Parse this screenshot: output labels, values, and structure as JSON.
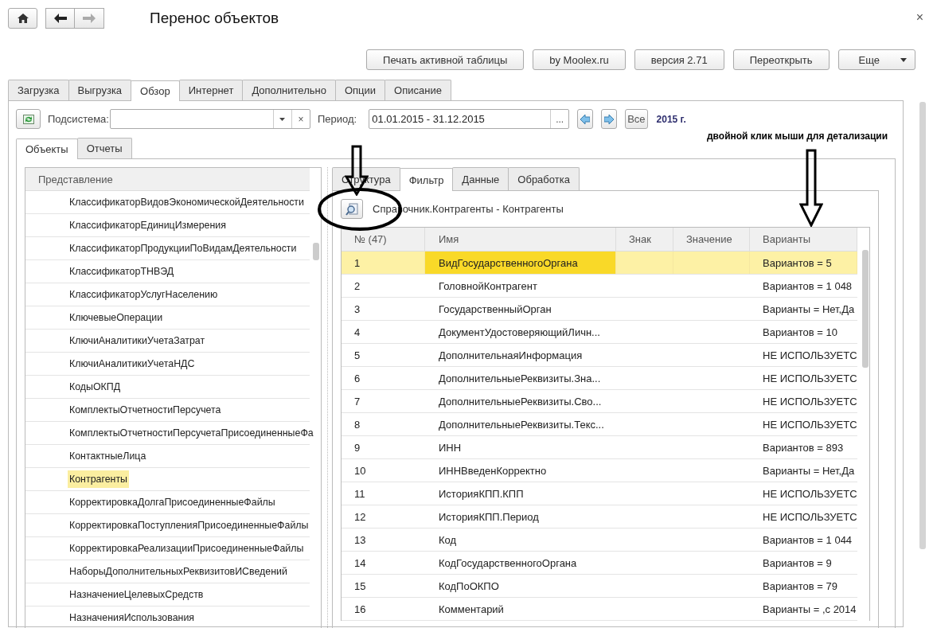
{
  "window": {
    "title": "Перенос объектов",
    "close": "×"
  },
  "commands": [
    {
      "kind": "button",
      "label": "Печать активной таблицы"
    },
    {
      "kind": "button",
      "label": "by Moolex.ru"
    },
    {
      "kind": "button",
      "label": "версия 2.71"
    },
    {
      "kind": "button",
      "label": "Переоткрыть"
    },
    {
      "kind": "menu",
      "label": "Еще"
    }
  ],
  "tabs": [
    {
      "label": "Загрузка",
      "selected": false
    },
    {
      "label": "Выгрузка",
      "selected": false
    },
    {
      "label": "Обзор",
      "selected": true
    },
    {
      "label": "Интернет",
      "selected": false
    },
    {
      "label": "Дополнительно",
      "selected": false
    },
    {
      "label": "Опции",
      "selected": false
    },
    {
      "label": "Описание",
      "selected": false
    }
  ],
  "toolbar": {
    "subsystem_label": "Подсистема:",
    "subsystem_clear": "×",
    "period_label": "Период:",
    "period_value": "01.01.2015 - 31.12.2015",
    "period_choice": "...",
    "all_button": "Все",
    "year": "2015 г."
  },
  "subtabs": [
    {
      "label": "Объекты",
      "selected": true
    },
    {
      "label": "Отчеты",
      "selected": false
    }
  ],
  "object_list": {
    "header": "Представление",
    "items": [
      {
        "label": "КлассификаторВидовЭкономическойДеятельности",
        "selected": false
      },
      {
        "label": "КлассификаторЕдиницИзмерения",
        "selected": false
      },
      {
        "label": "КлассификаторПродукцииПоВидамДеятельности",
        "selected": false
      },
      {
        "label": "КлассификаторТНВЭД",
        "selected": false
      },
      {
        "label": "КлассификаторУслугНаселению",
        "selected": false
      },
      {
        "label": "КлючевыеОперации",
        "selected": false
      },
      {
        "label": "КлючиАналитикиУчетаЗатрат",
        "selected": false
      },
      {
        "label": "КлючиАналитикиУчетаНДС",
        "selected": false
      },
      {
        "label": "КодыОКПД",
        "selected": false
      },
      {
        "label": "КомплектыОтчетностиПерсучета",
        "selected": false
      },
      {
        "label": "КомплектыОтчетностиПерсучетаПрисоединенныеФа",
        "selected": false
      },
      {
        "label": "КонтактныеЛица",
        "selected": false
      },
      {
        "label": "Контрагенты",
        "selected": true
      },
      {
        "label": "КорректировкаДолгаПрисоединенныеФайлы",
        "selected": false
      },
      {
        "label": "КорректировкаПоступленияПрисоединенныеФайлы",
        "selected": false
      },
      {
        "label": "КорректировкаРеализацииПрисоединенныеФайлы",
        "selected": false
      },
      {
        "label": "НаборыДополнительныхРеквизитовИСведений",
        "selected": false
      },
      {
        "label": "НазначениеЦелевыхСредств",
        "selected": false
      },
      {
        "label": "НазначенияИспользования",
        "selected": false
      }
    ]
  },
  "detail_tabs": [
    {
      "label": "Структура",
      "selected": false
    },
    {
      "label": "Фильтр",
      "selected": true
    },
    {
      "label": "Данные",
      "selected": false
    },
    {
      "label": "Обработка",
      "selected": false
    }
  ],
  "filter": {
    "object": "Справочник.Контрагенты - Контрагенты",
    "columns": [
      "№ (47)",
      "Имя",
      "Знак",
      "Значение",
      "Варианты"
    ],
    "rows": [
      {
        "selected": true,
        "cells": [
          "1",
          "ВидГосударственногоОргана",
          "",
          "",
          "Вариантов = 5"
        ]
      },
      {
        "selected": false,
        "cells": [
          "2",
          "ГоловнойКонтрагент",
          "",
          "",
          "Вариантов = 1 048"
        ]
      },
      {
        "selected": false,
        "cells": [
          "3",
          "ГосударственныйОрган",
          "",
          "",
          "Варианты = Нет,Да"
        ]
      },
      {
        "selected": false,
        "cells": [
          "4",
          "ДокументУдостоверяющийЛичн...",
          "",
          "",
          "Вариантов = 10"
        ]
      },
      {
        "selected": false,
        "cells": [
          "5",
          "ДополнительнаяИнформация",
          "",
          "",
          "НЕ ИСПОЛЬЗУЕТС"
        ]
      },
      {
        "selected": false,
        "cells": [
          "6",
          "ДополнительныеРеквизиты.Зна...",
          "",
          "",
          "НЕ ИСПОЛЬЗУЕТС"
        ]
      },
      {
        "selected": false,
        "cells": [
          "7",
          "ДополнительныеРеквизиты.Сво...",
          "",
          "",
          "НЕ ИСПОЛЬЗУЕТС"
        ]
      },
      {
        "selected": false,
        "cells": [
          "8",
          "ДополнительныеРеквизиты.Текс...",
          "",
          "",
          "НЕ ИСПОЛЬЗУЕТС"
        ]
      },
      {
        "selected": false,
        "cells": [
          "9",
          "ИНН",
          "",
          "",
          "Вариантов = 893"
        ]
      },
      {
        "selected": false,
        "cells": [
          "10",
          "ИННВведенКорректно",
          "",
          "",
          "Варианты = Нет,Да"
        ]
      },
      {
        "selected": false,
        "cells": [
          "11",
          "ИсторияКПП.КПП",
          "",
          "",
          "НЕ ИСПОЛЬЗУЕТС"
        ]
      },
      {
        "selected": false,
        "cells": [
          "12",
          "ИсторияКПП.Период",
          "",
          "",
          "НЕ ИСПОЛЬЗУЕТС"
        ]
      },
      {
        "selected": false,
        "cells": [
          "13",
          "Код",
          "",
          "",
          "Вариантов = 1 044"
        ]
      },
      {
        "selected": false,
        "cells": [
          "14",
          "КодГосударственногоОргана",
          "",
          "",
          "Вариантов = 9"
        ]
      },
      {
        "selected": false,
        "cells": [
          "15",
          "КодПоОКПО",
          "",
          "",
          "Вариантов = 79"
        ]
      },
      {
        "selected": false,
        "cells": [
          "16",
          "Комментарий",
          "",
          "",
          "Варианты = ,с 2014"
        ]
      }
    ]
  },
  "annotation": {
    "caption": "двойной клик мыши  для детализации"
  }
}
